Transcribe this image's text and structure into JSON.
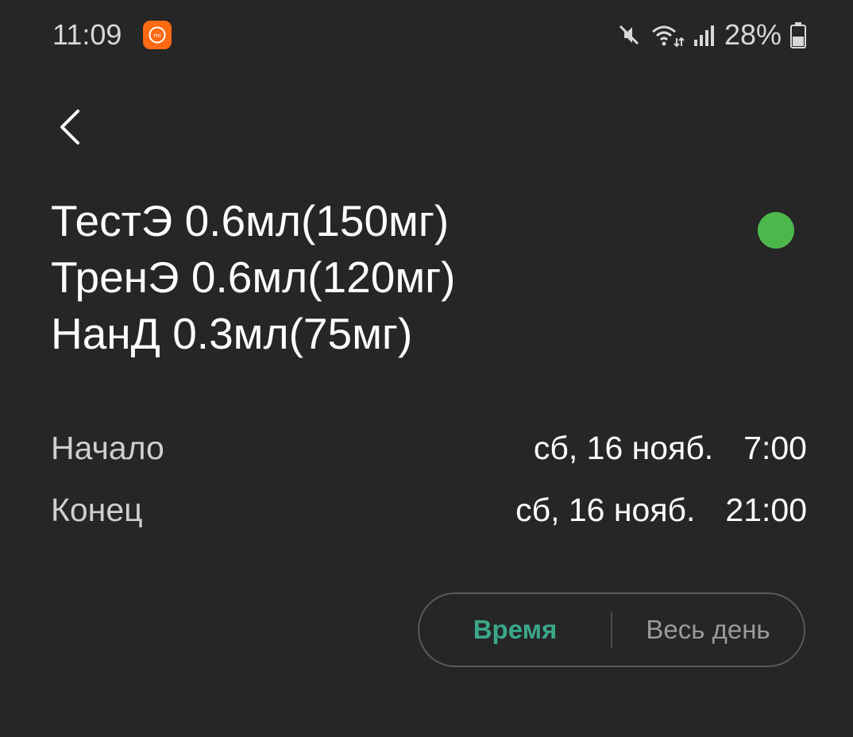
{
  "status_bar": {
    "time": "11:09",
    "mi_icon_text": "mi",
    "battery_text": "28%",
    "icons": [
      "mute-icon",
      "wifi-icon",
      "signal-icon",
      "battery-icon"
    ]
  },
  "event": {
    "title_lines": [
      "ТестЭ 0.6мл(150мг)",
      "ТренЭ 0.6мл(120мг)",
      "НанД 0.3мл(75мг)"
    ],
    "color": "#4cb84c"
  },
  "start": {
    "label": "Начало",
    "date": "сб, 16 нояб.",
    "time": "7:00"
  },
  "end": {
    "label": "Конец",
    "date": "сб, 16 нояб.",
    "time": "21:00"
  },
  "mode_toggle": {
    "time_label": "Время",
    "all_day_label": "Весь день",
    "selected": "Время"
  },
  "colors": {
    "background": "#262626",
    "accent": "#3aa889"
  }
}
